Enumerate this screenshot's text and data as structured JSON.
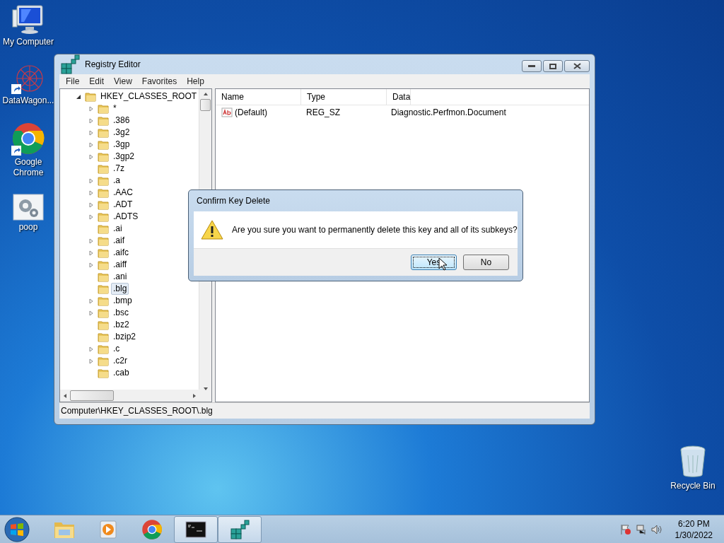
{
  "desktop_icons": [
    {
      "label": "My Computer",
      "kind": "computer",
      "shortcut": false
    },
    {
      "label": "DataWagon...",
      "kind": "web",
      "shortcut": true
    },
    {
      "label": "Google Chrome",
      "kind": "chrome",
      "shortcut": true
    },
    {
      "label": "poop",
      "kind": "gears",
      "shortcut": false
    }
  ],
  "recycle_bin": {
    "label": "Recycle Bin"
  },
  "window": {
    "title": "Registry Editor",
    "menu": [
      "File",
      "Edit",
      "View",
      "Favorites",
      "Help"
    ],
    "tree": {
      "label": "HKEY_CLASSES_ROOT",
      "expanded": true,
      "children": [
        {
          "label": "*",
          "expandable": true,
          "selected": false
        },
        {
          "label": ".386",
          "expandable": true,
          "selected": false
        },
        {
          "label": ".3g2",
          "expandable": true,
          "selected": false
        },
        {
          "label": ".3gp",
          "expandable": true,
          "selected": false
        },
        {
          "label": ".3gp2",
          "expandable": true,
          "selected": false
        },
        {
          "label": ".7z",
          "expandable": false,
          "selected": false
        },
        {
          "label": ".a",
          "expandable": true,
          "selected": false
        },
        {
          "label": ".AAC",
          "expandable": true,
          "selected": false
        },
        {
          "label": ".ADT",
          "expandable": true,
          "selected": false
        },
        {
          "label": ".ADTS",
          "expandable": true,
          "selected": false
        },
        {
          "label": ".ai",
          "expandable": false,
          "selected": false
        },
        {
          "label": ".aif",
          "expandable": true,
          "selected": false
        },
        {
          "label": ".aifc",
          "expandable": true,
          "selected": false
        },
        {
          "label": ".aiff",
          "expandable": true,
          "selected": false
        },
        {
          "label": ".ani",
          "expandable": false,
          "selected": false
        },
        {
          "label": ".blg",
          "expandable": false,
          "selected": true
        },
        {
          "label": ".bmp",
          "expandable": true,
          "selected": false
        },
        {
          "label": ".bsc",
          "expandable": true,
          "selected": false
        },
        {
          "label": ".bz2",
          "expandable": false,
          "selected": false
        },
        {
          "label": ".bzip2",
          "expandable": false,
          "selected": false
        },
        {
          "label": ".c",
          "expandable": true,
          "selected": false
        },
        {
          "label": ".c2r",
          "expandable": true,
          "selected": false
        },
        {
          "label": ".cab",
          "expandable": false,
          "selected": false
        }
      ]
    },
    "columns": [
      "Name",
      "Type",
      "Data"
    ],
    "rows": [
      {
        "name": "(Default)",
        "type": "REG_SZ",
        "data": "Diagnostic.Perfmon.Document"
      }
    ],
    "status_bar": "Computer\\HKEY_CLASSES_ROOT\\.blg"
  },
  "dialog": {
    "title": "Confirm Key Delete",
    "message": "Are you sure you want to permanently delete this key and all of its subkeys?",
    "buttons": [
      {
        "label": "Yes",
        "default": true
      },
      {
        "label": "No",
        "default": false
      }
    ]
  },
  "taskbar": {
    "items": [
      {
        "kind": "explorer",
        "active": false
      },
      {
        "kind": "media",
        "active": false
      },
      {
        "kind": "chrome",
        "active": false
      },
      {
        "kind": "cmd",
        "active": true
      },
      {
        "kind": "regedit",
        "active": true
      }
    ],
    "time": "6:20 PM",
    "date": "1/30/2022"
  }
}
